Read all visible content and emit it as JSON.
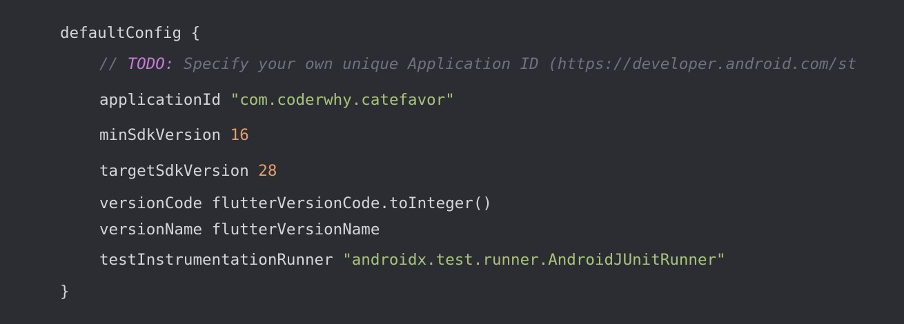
{
  "code": {
    "block_name": "defaultConfig",
    "open_brace": "{",
    "close_brace": "}",
    "comment": {
      "prefix": "// ",
      "todo": "TODO:",
      "text": " Specify your own unique Application ID (https://developer.android.com/st"
    },
    "applicationId": {
      "key": "applicationId",
      "value": "\"com.coderwhy.catefavor\""
    },
    "minSdkVersion": {
      "key": "minSdkVersion",
      "value": "16"
    },
    "targetSdkVersion": {
      "key": "targetSdkVersion",
      "value": "28"
    },
    "versionCode": {
      "key": "versionCode",
      "value": "flutterVersionCode.toInteger()"
    },
    "versionName": {
      "key": "versionName",
      "value": "flutterVersionName"
    },
    "testInstrumentationRunner": {
      "key": "testInstrumentationRunner",
      "value": "\"androidx.test.runner.AndroidJUnitRunner\""
    }
  },
  "colors": {
    "background": "#2b2d33",
    "text": "#d3d5da",
    "string": "#a8c47a",
    "number": "#e0a06a",
    "comment": "#6e727c",
    "todo": "#c77dd7"
  }
}
